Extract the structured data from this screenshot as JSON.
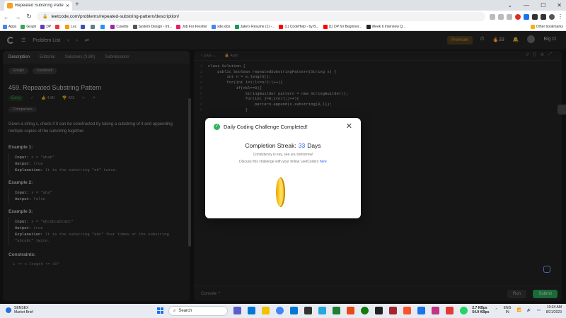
{
  "browser": {
    "tab_title": "Repeated Substring Pattern - Le...",
    "tab_close": "✕",
    "new_tab": "+",
    "url": "leetcode.com/problems/repeated-substring-pattern/description/",
    "window_controls": [
      "⌄",
      "—",
      "☐",
      "✕"
    ],
    "bookmarks": [
      "Apps",
      "Graph",
      "DP",
      "",
      "Lec",
      "",
      "",
      "",
      "Cuvette",
      "System Design - Int...",
      "Job For Fresher",
      "sde jobs",
      "Jake's Resume (1) -...",
      "(1) CodeHelp - by B...",
      "(1) DP for Beginner...",
      "Week 6 Interview Q..."
    ],
    "other_bookmarks": "Other bookmarks"
  },
  "leetcode": {
    "nav": {
      "problem_list": "Problem List",
      "premium": "Premium",
      "streak": "33",
      "user": "Big O"
    },
    "left_tabs": [
      "Description",
      "Editorial",
      "Solutions (3.8K)",
      "Submissions"
    ],
    "tags": [
      "Google",
      "Facebook"
    ],
    "problem_title": "459. Repeated Substring Pattern",
    "difficulty": "Easy",
    "likes": "4.9K",
    "dislikes": "423",
    "companies": "Companies",
    "description": "Given a string s, check if it can be constructed by taking a substring of it and appending multiple copies of the substring together.",
    "examples": [
      {
        "title": "Example 1:",
        "input": "s = \"abab\"",
        "output": "true",
        "explanation": "It is the substring \"ab\" twice."
      },
      {
        "title": "Example 2:",
        "input": "s = \"aba\"",
        "output": "false",
        "explanation": ""
      },
      {
        "title": "Example 3:",
        "input": "s = \"abcabcabcabc\"",
        "output": "true",
        "explanation": "It is the substring \"abc\" four times or the substring \"abcabc\" twice."
      }
    ],
    "labels": {
      "input": "Input:",
      "output": "Output:",
      "explanation": "Explanation:"
    },
    "constraints_title": "Constraints:",
    "constraint_1": "1 <= s.length <= 10⁴",
    "editor": {
      "language": "Java",
      "mode": "Auto",
      "lines": [
        "class Solution {",
        "    public boolean repeatedSubstringPattern(String s) {",
        "        int n = s.length();",
        "        for(int l=1;l<=n/2;l++){",
        "            if(n%l==0){",
        "                StringBuilder pattern = new StringBuilder();",
        "                for(int j=0;j<n/l;j++){",
        "                    pattern.append(s.substring(0,l));",
        "                }"
      ]
    },
    "console": "Console",
    "run": "Run",
    "submit": "Submit"
  },
  "modal": {
    "title": "Daily Coding Challenge Completed!",
    "close": "✕",
    "streak_label": "Completion Streak:",
    "streak_value": "33",
    "streak_unit": "Days",
    "line1": "Consistency is key, see you tomorrow!",
    "line2_prefix": "Discuss this challenge with your fellow LeetCoders",
    "line2_link": "here"
  },
  "taskbar": {
    "weather_title": "SENSEX",
    "weather_sub": "Market Brief",
    "search": "Search",
    "net_up": "2.7 KBps",
    "net_down": "54.9 KBps",
    "lang": "ENG",
    "region": "IN",
    "time": "10:34 AM",
    "date": "8/21/2023"
  }
}
